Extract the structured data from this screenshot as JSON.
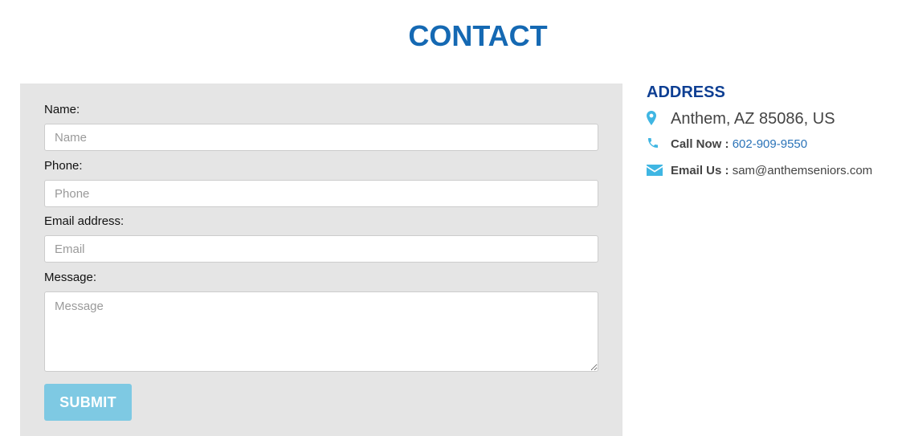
{
  "title": "CONTACT",
  "form": {
    "fields": [
      {
        "label": "Name:",
        "placeholder": "Name"
      },
      {
        "label": "Phone:",
        "placeholder": "Phone"
      },
      {
        "label": "Email address:",
        "placeholder": "Email"
      }
    ],
    "message": {
      "label": "Message:",
      "placeholder": "Message"
    },
    "submit_label": "SUBMIT"
  },
  "contact": {
    "heading": "ADDRESS",
    "address": "Anthem, AZ 85086, US",
    "phone_label": "Call Now :",
    "phone": "602-909-9550",
    "email_label": "Email Us :",
    "email": "sam@anthemseniors.com"
  },
  "icons": {
    "address": "map-pin-icon",
    "phone": "phone-icon",
    "email": "envelope-icon"
  },
  "colors": {
    "title": "#1569b3",
    "heading": "#0e3f93",
    "icon": "#3fb6e3",
    "submit": "#7ec9e3",
    "form_background": "#e5e5e5",
    "link": "#2a73b8"
  }
}
